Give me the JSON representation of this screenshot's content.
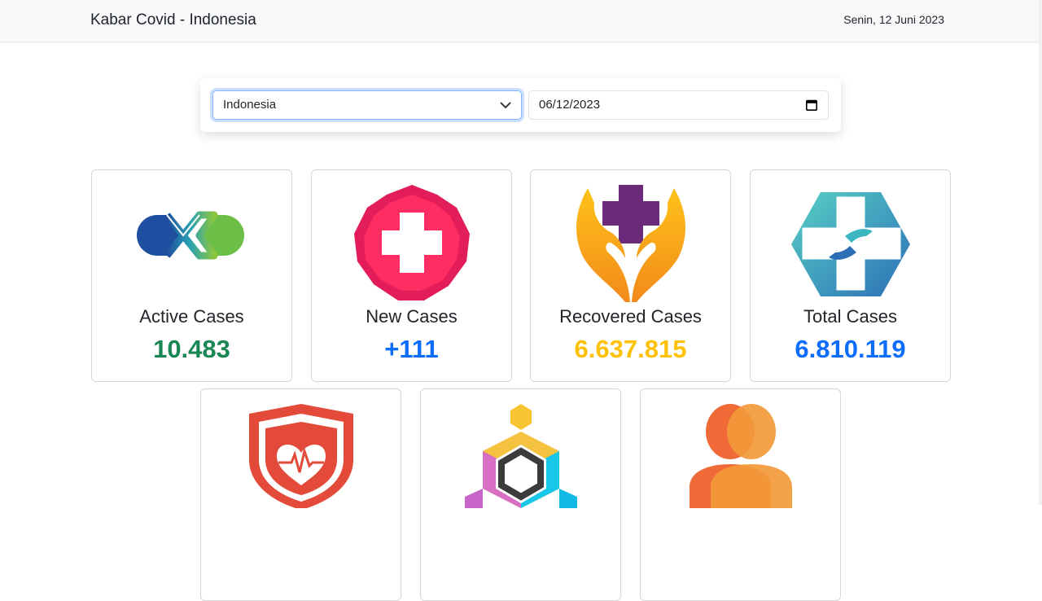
{
  "header": {
    "brand": "Kabar Covid - Indonesia",
    "date": "Senin, 12 Juni 2023"
  },
  "filter": {
    "country": "Indonesia",
    "date_value": "06/12/2023"
  },
  "stats": [
    {
      "label": "Active Cases",
      "value": "10.483",
      "color": "#198754",
      "icon": "dna-icon"
    },
    {
      "label": "New Cases",
      "value": "+111",
      "color": "#0d6efd",
      "icon": "medical-cross-icon"
    },
    {
      "label": "Recovered Cases",
      "value": "6.637.815",
      "color": "#ffc107",
      "icon": "caring-hands-cross-icon"
    },
    {
      "label": "Total Cases",
      "value": "6.810.119",
      "color": "#0d6efd",
      "icon": "hexagon-cross-hands-icon"
    }
  ],
  "stats_row2": [
    {
      "icon": "heart-shield-icon"
    },
    {
      "icon": "hexagon-blocks-icon"
    },
    {
      "icon": "people-icon"
    }
  ]
}
